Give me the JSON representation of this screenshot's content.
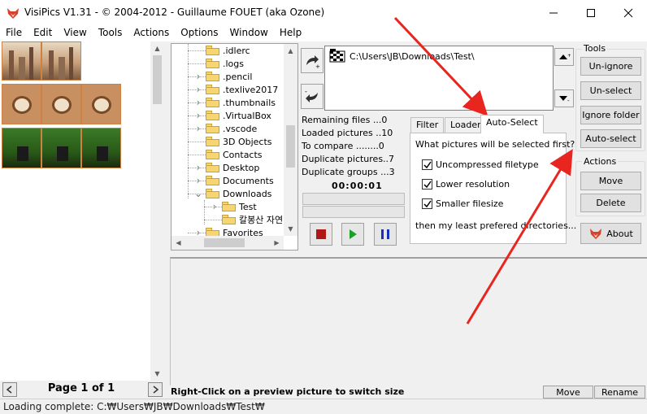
{
  "window": {
    "title": "VisiPics V1.31 - © 2004-2012 - Guillaume FOUET (aka Ozone)",
    "minimize_icon": "minimize-icon",
    "maximize_icon": "maximize-icon",
    "close_icon": "close-icon"
  },
  "menu": [
    "File",
    "Edit",
    "View",
    "Tools",
    "Actions",
    "Options",
    "Window",
    "Help"
  ],
  "thumbnails": {
    "page_label": "Page 1 of 1",
    "prev_icon": "arrow-left-icon",
    "next_icon": "arrow-right-icon"
  },
  "tree": {
    "items": [
      {
        "label": ".idlerc",
        "expander": false
      },
      {
        "label": ".logs",
        "expander": false
      },
      {
        "label": ".pencil",
        "expander": true
      },
      {
        "label": ".texlive2017",
        "expander": true
      },
      {
        "label": ".thumbnails",
        "expander": true
      },
      {
        "label": ".VirtualBox",
        "expander": true
      },
      {
        "label": ".vscode",
        "expander": true
      },
      {
        "label": "3D Objects",
        "expander": false
      },
      {
        "label": "Contacts",
        "expander": false
      },
      {
        "label": "Desktop",
        "expander": true
      },
      {
        "label": "Documents",
        "expander": true
      },
      {
        "label": "Downloads",
        "expander": true,
        "expanded": true
      },
      {
        "label": "Test",
        "expander": true,
        "indent": 1,
        "open": true
      },
      {
        "label": "칼봉산 자연",
        "expander": false,
        "indent": 1
      },
      {
        "label": "Favorites",
        "expander": true
      }
    ]
  },
  "path": {
    "add_icon": "add-folder-icon",
    "remove_icon": "remove-folder-icon",
    "folder_icon": "checkered-folder-icon",
    "entry": "C:\\Users\\JB\\Downloads\\Test\\",
    "move_up_icon": "move-up-icon",
    "move_down_icon": "move-down-icon"
  },
  "stats": {
    "remaining": "Remaining files ...0",
    "loaded": "Loaded pictures ..10",
    "to_compare": "To compare ........0",
    "duplicate_pictures": "Duplicate pictures..7",
    "duplicate_groups": "Duplicate groups ...3",
    "timer": "00:00:01"
  },
  "controls": {
    "stop_icon": "stop-icon",
    "play_icon": "play-icon",
    "pause_icon": "pause-icon"
  },
  "tabs": {
    "items": [
      "Filter",
      "Loader",
      "Auto-Select"
    ],
    "active": "Auto-Select",
    "question": "What pictures will be selected first?",
    "options": [
      {
        "label": "Uncompressed filetype",
        "checked": true
      },
      {
        "label": "Lower resolution",
        "checked": true
      },
      {
        "label": "Smaller filesize",
        "checked": true
      }
    ],
    "footer": "then my least prefered directories..."
  },
  "tools": {
    "title": "Tools",
    "buttons": [
      "Un-ignore",
      "Un-select",
      "Ignore folder",
      "Auto-select"
    ]
  },
  "actions": {
    "title": "Actions",
    "buttons": [
      "Move",
      "Delete"
    ]
  },
  "about": {
    "label": "About",
    "icon": "fox-icon"
  },
  "bottom": {
    "hint": "Right-Click on a preview picture to switch size",
    "move": "Move",
    "rename": "Rename"
  },
  "status": "Loading complete: C:₩Users₩JB₩Downloads₩Test₩",
  "colors": {
    "arrow": "#e8251f",
    "accent": "#d08040",
    "stop": "#b01818",
    "play": "#18a028",
    "pause": "#1830c0"
  }
}
